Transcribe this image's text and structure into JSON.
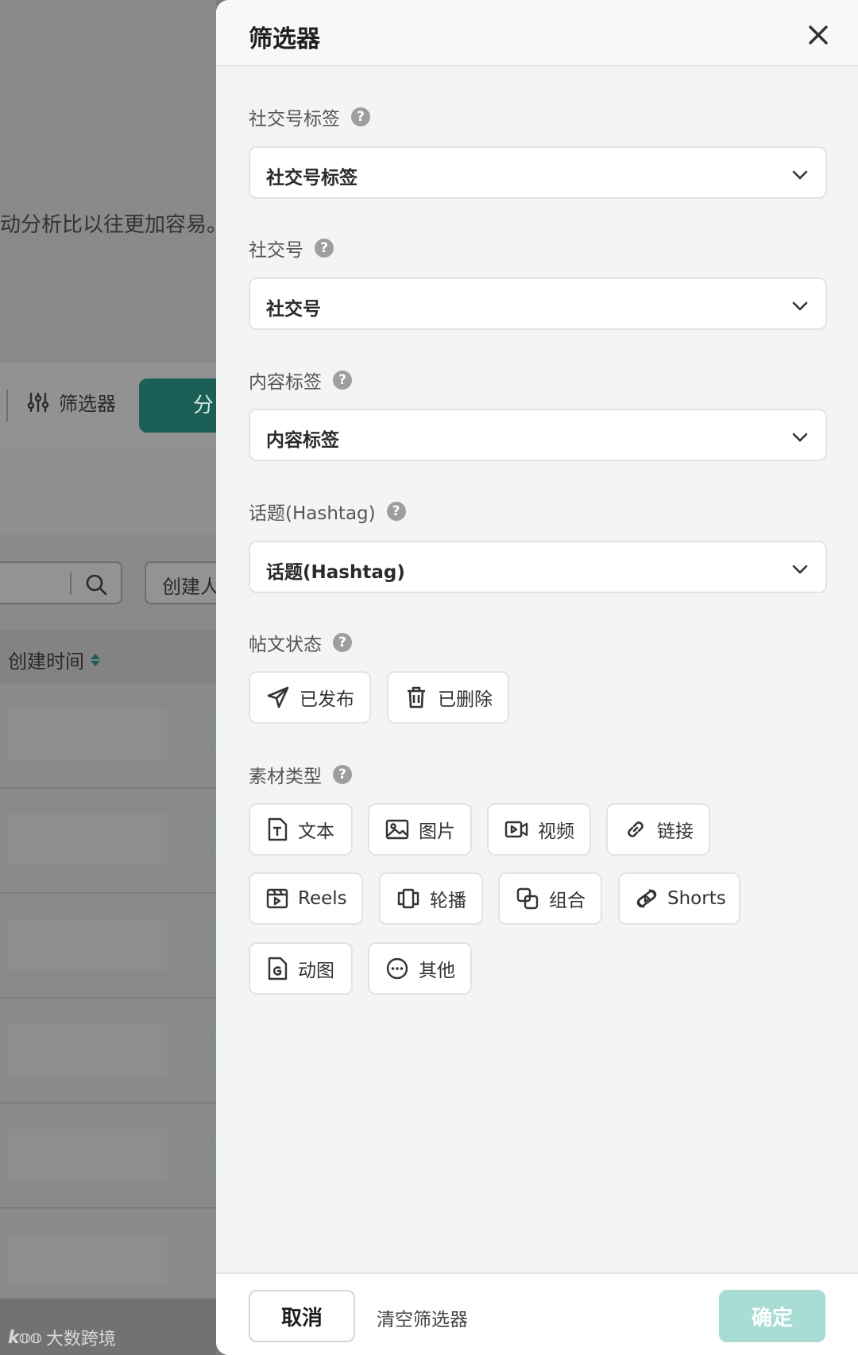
{
  "background": {
    "description_fragment": "动分析比以往更加容易。",
    "filter_button_label": "筛选器",
    "primary_button_label": "分",
    "creator_filter_label": "创建人",
    "table_header_created_time": "创建时间",
    "watermark_text": "大数跨境",
    "watermark_logo": "k𝕠𝕠"
  },
  "drawer": {
    "title": "筛选器",
    "sections": {
      "social_tag": {
        "label": "社交号标签",
        "placeholder": "社交号标签"
      },
      "social_account": {
        "label": "社交号",
        "placeholder": "社交号"
      },
      "content_tag": {
        "label": "内容标签",
        "placeholder": "内容标签"
      },
      "hashtag": {
        "label": "话题(Hashtag)",
        "placeholder": "话题(Hashtag)"
      },
      "post_status": {
        "label": "帖文状态",
        "options": [
          "已发布",
          "已删除"
        ]
      },
      "material_type": {
        "label": "素材类型",
        "options": [
          "文本",
          "图片",
          "视频",
          "链接",
          "Reels",
          "轮播",
          "组合",
          "Shorts",
          "动图",
          "其他"
        ]
      }
    },
    "help_glyph": "?",
    "footer": {
      "cancel": "取消",
      "clear": "清空筛选器",
      "confirm": "确定"
    }
  },
  "colors": {
    "primary": "#1c5f56",
    "confirm_disabled": "#a9dcd4",
    "help_icon": "#9e9e9e"
  }
}
